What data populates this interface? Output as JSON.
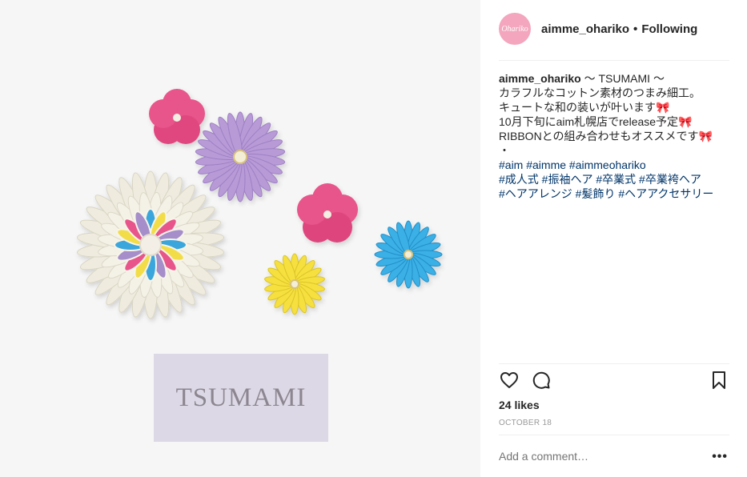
{
  "photo": {
    "card_text": "TSUMAMI"
  },
  "post": {
    "avatar_text": "Ohariko",
    "username": "aimme_ohariko",
    "separator": "•",
    "follow_status": "Following"
  },
  "caption": {
    "user": "aimme_ohariko",
    "first_line_text": " 〜 TSUMAMI 〜",
    "lines": [
      "カラフルなコットン素材のつまみ細工。",
      "キュートな和の装いが叶います🎀",
      "10月下旬にaim札幌店でrelease予定🎀",
      "RIBBONとの組み合わせもオススメです🎀",
      "・"
    ],
    "hashtag_lines": [
      "#aim #aimme #aimmeohariko",
      "#成人式 #振袖ヘア #卒業式 #卒業袴ヘア",
      "#ヘアアレンジ #髪飾り #ヘアアクセサリー"
    ]
  },
  "engagement": {
    "likes": "24 likes",
    "date": "OCTOBER 18"
  },
  "comment": {
    "placeholder": "Add a comment…",
    "more": "•••"
  },
  "icons": {
    "like": "heart-icon",
    "comment": "comment-icon",
    "save": "bookmark-icon",
    "more": "more-options-icon"
  },
  "colors": {
    "hashtag": "#003569",
    "meta": "#999999",
    "avatar": "#f3a6bd"
  }
}
